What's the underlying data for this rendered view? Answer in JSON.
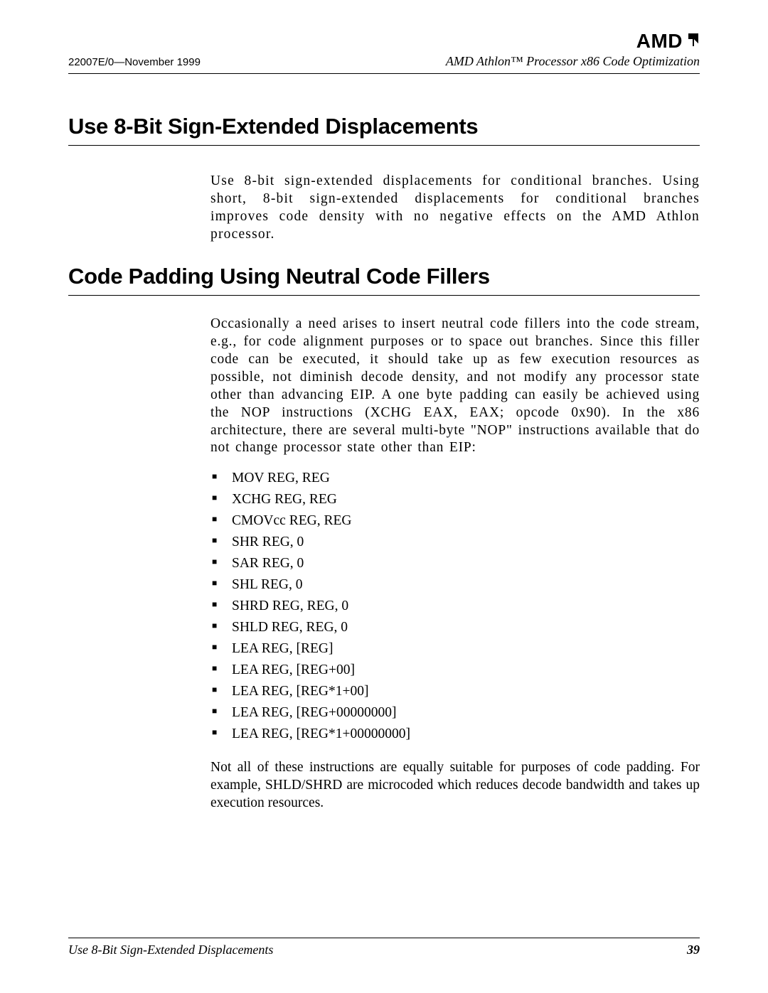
{
  "brand": "AMD",
  "header": {
    "doc_id": "22007E/0—November 1999",
    "title": "AMD Athlon™ Processor x86 Code Optimization"
  },
  "sections": [
    {
      "heading": "Use 8-Bit Sign-Extended Displacements",
      "paragraphs": [
        "Use 8-bit sign-extended displacements for conditional branches. Using short, 8-bit sign-extended displacements for conditional branches improves code density with no negative effects on the AMD Athlon processor."
      ]
    },
    {
      "heading": "Code Padding Using Neutral Code Fillers",
      "paragraphs": [
        "Occasionally a need arises to insert neutral code fillers into the code stream, e.g., for code alignment purposes or to space out branches. Since this filler code can be executed, it should take up as few execution resources as possible, not diminish decode density, and not modify any processor state other than advancing EIP. A one byte padding can easily be achieved using the NOP instructions (XCHG EAX, EAX; opcode 0x90). In the x86 architecture, there are several multi-byte \"NOP\" instructions available that do not change processor state other than EIP:"
      ],
      "list": [
        "MOV  REG, REG",
        "XCHG REG, REG",
        "CMOVcc REG, REG",
        "SHR  REG, 0",
        "SAR  REG, 0",
        "SHL  REG, 0",
        "SHRD REG, REG, 0",
        "SHLD REG, REG, 0",
        "LEA  REG, [REG]",
        "LEA  REG, [REG+00]",
        "LEA  REG, [REG*1+00]",
        "LEA  REG, [REG+00000000]",
        "LEA  REG, [REG*1+00000000]"
      ],
      "closing": "Not all of these instructions are equally suitable for purposes of code padding. For example, SHLD/SHRD are microcoded which reduces decode bandwidth and takes up execution resources."
    }
  ],
  "footer": {
    "section_ref": "Use 8-Bit Sign-Extended Displacements",
    "page": "39"
  }
}
